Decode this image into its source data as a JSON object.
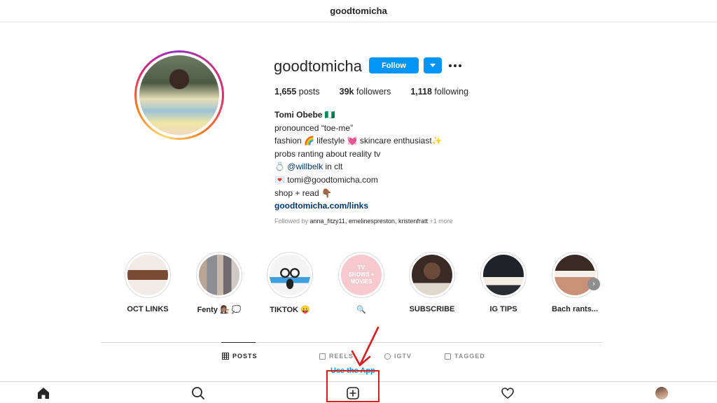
{
  "topbar": {
    "title": "goodtomicha"
  },
  "profile": {
    "username": "goodtomicha",
    "follow_label": "Follow",
    "stats": {
      "posts_count": "1,655",
      "posts_label": "posts",
      "followers_count": "39k",
      "followers_label": "followers",
      "following_count": "1,118",
      "following_label": "following"
    },
    "bio": {
      "name": "Tomi Obebe 🇳🇬",
      "line1": "pronounced “toe-me”",
      "line2": "fashion 🌈 lifestyle 💓 skincare enthusiast✨",
      "line3": "probs ranting about reality tv",
      "line4_emoji": "💍",
      "line4_mention": "@willbelk",
      "line4_rest": " in clt",
      "line5": "💌 tomi@goodtomicha.com",
      "line6": "shop + read 👇🏾",
      "link": "goodtomicha.com/links"
    },
    "followed_by": {
      "prefix": "Followed by ",
      "users": "anna_fitzy11, emelinespreston, kristenfratt",
      "more": " +1 more"
    }
  },
  "highlights": [
    {
      "label": "OCT LINKS",
      "thumb_text": ""
    },
    {
      "label": "Fenty 👩🏽‍⚖️ 💭",
      "thumb_text": ""
    },
    {
      "label": "TIKTOK 😛",
      "thumb_text": ""
    },
    {
      "label": "🔍",
      "thumb_text": "TV SHOWS + MOVIES"
    },
    {
      "label": "SUBSCRIBE",
      "thumb_text": ""
    },
    {
      "label": "IG TIPS",
      "thumb_text": ""
    },
    {
      "label": "Bach rants...",
      "thumb_text": ""
    }
  ],
  "tabs": [
    {
      "label": "POSTS",
      "active": true
    },
    {
      "label": "REELS",
      "active": false
    },
    {
      "label": "IGTV",
      "active": false
    },
    {
      "label": "TAGGED",
      "active": false
    }
  ],
  "use_app_label": "Use the App",
  "colors": {
    "accent": "#0095f6",
    "annotation": "#d61f1f",
    "link": "#00376b"
  },
  "icons": [
    "home-icon",
    "search-icon",
    "new-post-icon",
    "heart-icon",
    "profile-avatar"
  ]
}
